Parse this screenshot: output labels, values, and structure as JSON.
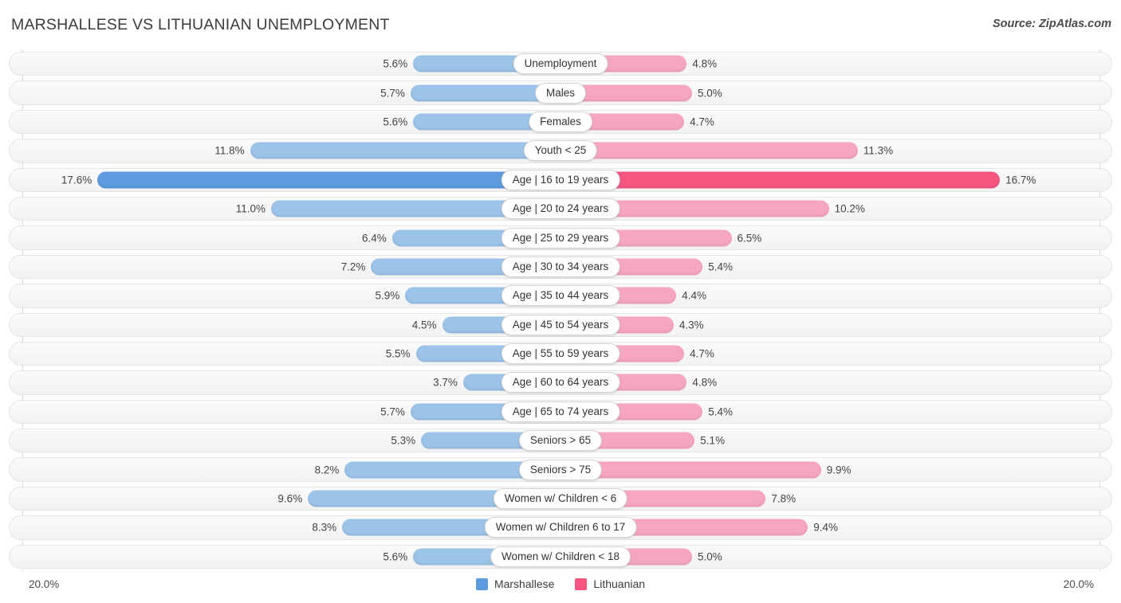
{
  "header": {
    "title": "MARSHALLESE VS LITHUANIAN UNEMPLOYMENT",
    "source": "Source: ZipAtlas.com"
  },
  "footer": {
    "axis_left": "20.0%",
    "axis_right": "20.0%",
    "legend": [
      {
        "label": "Marshallese",
        "color": "#5c9bde",
        "icon": "legend-swatch"
      },
      {
        "label": "Lithuanian",
        "color": "#f4567f",
        "icon": "legend-swatch"
      }
    ]
  },
  "colors": {
    "marshallese": "#9cc3e8",
    "marshallese_highlight": "#5c9bde",
    "lithuanian": "#f7a6c0",
    "lithuanian_highlight": "#f4567f",
    "track": "#f4f4f4",
    "title": "#3c3c3c"
  },
  "chart_data": {
    "type": "bar",
    "orientation": "horizontal-diverging",
    "title": "MARSHALLESE VS LITHUANIAN UNEMPLOYMENT",
    "xlabel": "",
    "ylabel": "",
    "axis_max": 20.0,
    "axis_unit": "%",
    "xlim": [
      20.0,
      20.0
    ],
    "grid": false,
    "legend_position": "bottom-center",
    "categories": [
      "Unemployment",
      "Males",
      "Females",
      "Youth < 25",
      "Age | 16 to 19 years",
      "Age | 20 to 24 years",
      "Age | 25 to 29 years",
      "Age | 30 to 34 years",
      "Age | 35 to 44 years",
      "Age | 45 to 54 years",
      "Age | 55 to 59 years",
      "Age | 60 to 64 years",
      "Age | 65 to 74 years",
      "Seniors > 65",
      "Seniors > 75",
      "Women w/ Children < 6",
      "Women w/ Children 6 to 17",
      "Women w/ Children < 18"
    ],
    "series": [
      {
        "name": "Marshallese",
        "side": "left",
        "values": [
          5.6,
          5.7,
          5.6,
          11.8,
          17.6,
          11.0,
          6.4,
          7.2,
          5.9,
          4.5,
          5.5,
          3.7,
          5.7,
          5.3,
          8.2,
          9.6,
          8.3,
          5.6
        ]
      },
      {
        "name": "Lithuanian",
        "side": "right",
        "values": [
          4.8,
          5.0,
          4.7,
          11.3,
          16.7,
          10.2,
          6.5,
          5.4,
          4.4,
          4.3,
          4.7,
          4.8,
          5.4,
          5.1,
          9.9,
          7.8,
          9.4,
          5.0
        ]
      }
    ],
    "highlighted_category": "Age | 16 to 19 years"
  },
  "rows": [
    {
      "label": "Unemployment",
      "left": "5.6%",
      "right": "4.8%",
      "left_val": 5.6,
      "right_val": 4.8,
      "highlight": false
    },
    {
      "label": "Males",
      "left": "5.7%",
      "right": "5.0%",
      "left_val": 5.7,
      "right_val": 5.0,
      "highlight": false
    },
    {
      "label": "Females",
      "left": "5.6%",
      "right": "4.7%",
      "left_val": 5.6,
      "right_val": 4.7,
      "highlight": false
    },
    {
      "label": "Youth < 25",
      "left": "11.8%",
      "right": "11.3%",
      "left_val": 11.8,
      "right_val": 11.3,
      "highlight": false
    },
    {
      "label": "Age | 16 to 19 years",
      "left": "17.6%",
      "right": "16.7%",
      "left_val": 17.6,
      "right_val": 16.7,
      "highlight": true
    },
    {
      "label": "Age | 20 to 24 years",
      "left": "11.0%",
      "right": "10.2%",
      "left_val": 11.0,
      "right_val": 10.2,
      "highlight": false
    },
    {
      "label": "Age | 25 to 29 years",
      "left": "6.4%",
      "right": "6.5%",
      "left_val": 6.4,
      "right_val": 6.5,
      "highlight": false
    },
    {
      "label": "Age | 30 to 34 years",
      "left": "7.2%",
      "right": "5.4%",
      "left_val": 7.2,
      "right_val": 5.4,
      "highlight": false
    },
    {
      "label": "Age | 35 to 44 years",
      "left": "5.9%",
      "right": "4.4%",
      "left_val": 5.9,
      "right_val": 4.4,
      "highlight": false
    },
    {
      "label": "Age | 45 to 54 years",
      "left": "4.5%",
      "right": "4.3%",
      "left_val": 4.5,
      "right_val": 4.3,
      "highlight": false
    },
    {
      "label": "Age | 55 to 59 years",
      "left": "5.5%",
      "right": "4.7%",
      "left_val": 5.5,
      "right_val": 4.7,
      "highlight": false
    },
    {
      "label": "Age | 60 to 64 years",
      "left": "3.7%",
      "right": "4.8%",
      "left_val": 3.7,
      "right_val": 4.8,
      "highlight": false
    },
    {
      "label": "Age | 65 to 74 years",
      "left": "5.7%",
      "right": "5.4%",
      "left_val": 5.7,
      "right_val": 5.4,
      "highlight": false
    },
    {
      "label": "Seniors > 65",
      "left": "5.3%",
      "right": "5.1%",
      "left_val": 5.3,
      "right_val": 5.1,
      "highlight": false
    },
    {
      "label": "Seniors > 75",
      "left": "8.2%",
      "right": "9.9%",
      "left_val": 8.2,
      "right_val": 9.9,
      "highlight": false
    },
    {
      "label": "Women w/ Children < 6",
      "left": "9.6%",
      "right": "7.8%",
      "left_val": 9.6,
      "right_val": 7.8,
      "highlight": false
    },
    {
      "label": "Women w/ Children 6 to 17",
      "left": "8.3%",
      "right": "9.4%",
      "left_val": 8.3,
      "right_val": 9.4,
      "highlight": false
    },
    {
      "label": "Women w/ Children < 18",
      "left": "5.6%",
      "right": "5.0%",
      "left_val": 5.6,
      "right_val": 5.0,
      "highlight": false
    }
  ]
}
